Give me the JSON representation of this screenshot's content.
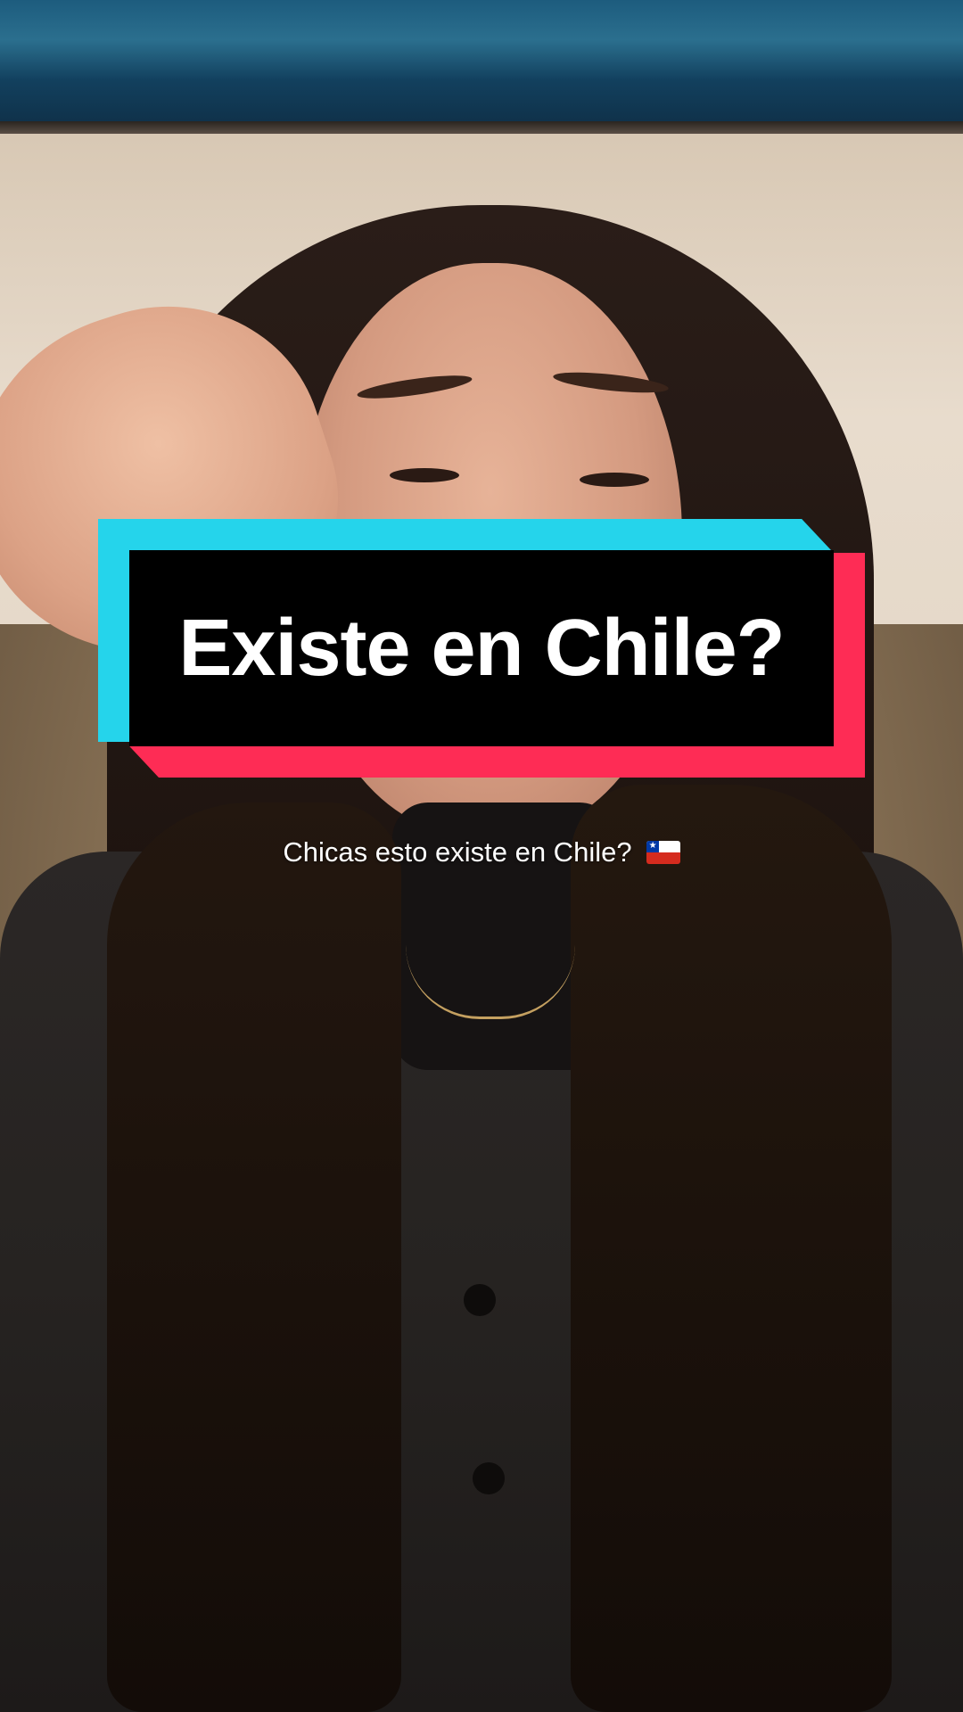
{
  "video": {
    "title_sticker": "Existe en Chile?",
    "caption": "Chicas esto existe en Chile?",
    "caption_icon": "chile-flag-icon"
  },
  "colors": {
    "sticker_cyan": "#25d4eb",
    "sticker_red": "#fe2c55",
    "sticker_black": "#000000",
    "text": "#ffffff"
  }
}
